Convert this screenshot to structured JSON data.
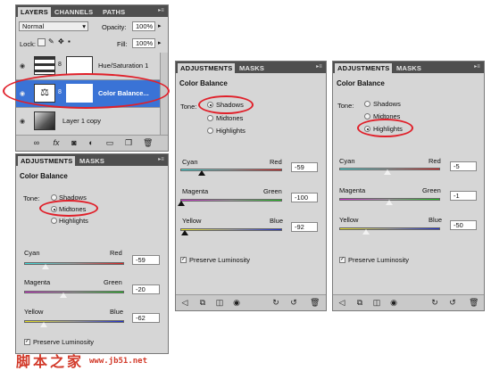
{
  "layers_panel": {
    "tabs": [
      "LAYERS",
      "CHANNELS",
      "PATHS"
    ],
    "blend_mode": "Normal",
    "opacity_label": "Opacity:",
    "opacity_value": "100%",
    "lock_label": "Lock:",
    "fill_label": "Fill:",
    "fill_value": "100%",
    "layers": [
      {
        "name": "Hue/Saturation 1"
      },
      {
        "name": "Color Balance..."
      },
      {
        "name": "Layer 1 copy"
      }
    ]
  },
  "adj_midtones": {
    "tabs": [
      "ADJUSTMENTS",
      "MASKS"
    ],
    "title": "Color Balance",
    "tone_label": "Tone:",
    "tone_options": [
      "Shadows",
      "Midtones",
      "Highlights"
    ],
    "selected": "Midtones",
    "sliders": [
      {
        "left": "Cyan",
        "right": "Red",
        "value": "-59"
      },
      {
        "left": "Magenta",
        "right": "Green",
        "value": "-20"
      },
      {
        "left": "Yellow",
        "right": "Blue",
        "value": "-62"
      }
    ],
    "preserve": "Preserve Luminosity"
  },
  "adj_shadows": {
    "tabs": [
      "ADJUSTMENTS",
      "MASKS"
    ],
    "title": "Color Balance",
    "tone_label": "Tone:",
    "tone_options": [
      "Shadows",
      "Midtones",
      "Highlights"
    ],
    "selected": "Shadows",
    "sliders": [
      {
        "left": "Cyan",
        "right": "Red",
        "value": "-59"
      },
      {
        "left": "Magenta",
        "right": "Green",
        "value": "-100"
      },
      {
        "left": "Yellow",
        "right": "Blue",
        "value": "-92"
      }
    ],
    "preserve": "Preserve Luminosity"
  },
  "adj_highlights": {
    "tabs": [
      "ADJUSTMENTS",
      "MASKS"
    ],
    "title": "Color Balance",
    "tone_label": "Tone:",
    "tone_options": [
      "Shadows",
      "Midtones",
      "Highlights"
    ],
    "selected": "Highlights",
    "sliders": [
      {
        "left": "Cyan",
        "right": "Red",
        "value": "-5"
      },
      {
        "left": "Magenta",
        "right": "Green",
        "value": "-1"
      },
      {
        "left": "Yellow",
        "right": "Blue",
        "value": "-50"
      }
    ],
    "preserve": "Preserve Luminosity"
  },
  "watermark": {
    "brand": "脚本之家",
    "url": "www.jb51.net"
  },
  "colors": {
    "highlight_ring": "#e0202a",
    "selection": "#3a73d6",
    "panel_tab_bar": "#4f4f4f"
  }
}
